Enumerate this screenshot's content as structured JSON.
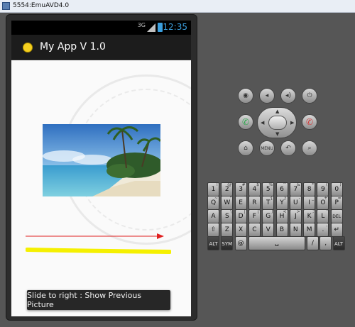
{
  "window": {
    "title": "5554:EmuAVD4.0"
  },
  "status_bar": {
    "network": "3G",
    "time": "12:35"
  },
  "action_bar": {
    "app_title": "My App V 1.0"
  },
  "toast": {
    "message": "Slide to right : Show Previous Picture"
  },
  "colors": {
    "accent_blue": "#3b9fde",
    "red_arrow": "#e02020",
    "yellow_stroke": "#f5f000",
    "call_green": "#2fa84f",
    "end_red": "#d23b3b"
  },
  "hardware_buttons": {
    "camera": "camera-icon",
    "volume_down": "volume-down-icon",
    "volume_up": "volume-up-icon",
    "power": "power-icon",
    "call": "call-icon",
    "end_call": "end-call-icon",
    "home": "home-icon",
    "menu": "MENU",
    "back": "back-icon",
    "search": "search-icon"
  },
  "keyboard": {
    "row1": [
      {
        "main": "1",
        "sub": "!"
      },
      {
        "main": "2",
        "sub": "@"
      },
      {
        "main": "3",
        "sub": "#"
      },
      {
        "main": "4",
        "sub": "$"
      },
      {
        "main": "5",
        "sub": "%"
      },
      {
        "main": "6",
        "sub": "^"
      },
      {
        "main": "7",
        "sub": "&"
      },
      {
        "main": "8",
        "sub": "*"
      },
      {
        "main": "9",
        "sub": "("
      },
      {
        "main": "0",
        "sub": ")"
      }
    ],
    "row2": [
      {
        "main": "Q",
        "sub": "~"
      },
      {
        "main": "W",
        "sub": "\""
      },
      {
        "main": "E",
        "sub": "´"
      },
      {
        "main": "R",
        "sub": ""
      },
      {
        "main": "T",
        "sub": "{"
      },
      {
        "main": "Y",
        "sub": "}"
      },
      {
        "main": "U",
        "sub": "-"
      },
      {
        "main": "I",
        "sub": "_"
      },
      {
        "main": "O",
        "sub": "+"
      },
      {
        "main": "P",
        "sub": "="
      }
    ],
    "row3": [
      {
        "main": "A",
        "sub": "`"
      },
      {
        "main": "S",
        "sub": "\\"
      },
      {
        "main": "D",
        "sub": "|"
      },
      {
        "main": "F",
        "sub": "["
      },
      {
        "main": "G",
        "sub": "]"
      },
      {
        "main": "H",
        "sub": "<"
      },
      {
        "main": "J",
        "sub": ">"
      },
      {
        "main": "K",
        "sub": ";"
      },
      {
        "main": "L",
        "sub": "'"
      },
      {
        "main": "DEL",
        "sub": ""
      }
    ],
    "row4": [
      {
        "main": "⇧",
        "sub": ""
      },
      {
        "main": "Z",
        "sub": ""
      },
      {
        "main": "X",
        "sub": ""
      },
      {
        "main": "C",
        "sub": ""
      },
      {
        "main": "V",
        "sub": ""
      },
      {
        "main": "B",
        "sub": ""
      },
      {
        "main": "N",
        "sub": ""
      },
      {
        "main": "M",
        "sub": ""
      },
      {
        "main": ".",
        "sub": ","
      },
      {
        "main": "↵",
        "sub": ""
      }
    ],
    "row5": {
      "alt_left": "ALT",
      "sym": "SYM",
      "at": "@",
      "space": "␣",
      "slash": "/",
      "comma": ",",
      "alt_right": "ALT"
    }
  }
}
